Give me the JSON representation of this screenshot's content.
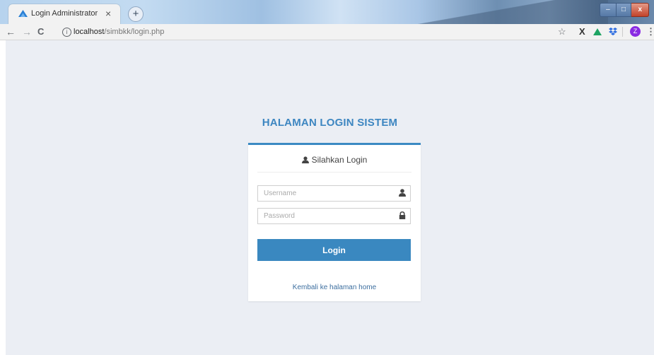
{
  "browser": {
    "tab_title": "Login Administrator",
    "tab_close": "×",
    "new_tab": "+",
    "nav": {
      "back": "←",
      "forward": "→",
      "reload": "C"
    },
    "address": {
      "info": "i",
      "host": "localhost",
      "path": "/simbkk/login.php"
    },
    "extensions": {
      "star": "☆",
      "x": "X",
      "menu": "⋮"
    },
    "profile_initial": "Z",
    "window_controls": {
      "minimize": "–",
      "maximize": "□",
      "close": "x"
    }
  },
  "page": {
    "heading": "HALAMAN LOGIN SISTEM",
    "card_title": "Silahkan Login",
    "username_placeholder": "Username",
    "password_placeholder": "Password",
    "login_button": "Login",
    "home_link": "Kembali ke halaman home"
  },
  "colors": {
    "accent": "#3a88c0",
    "heading": "#3d86c1",
    "page_background": "#ebeef4",
    "link": "#3c6e9f"
  }
}
